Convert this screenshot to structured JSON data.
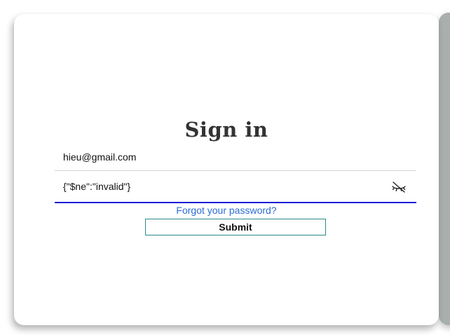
{
  "form": {
    "title": "Sign in",
    "email_value": "hieu@gmail.com",
    "password_value": "{\"$ne\":\"invalid\"}",
    "password_visibility_icon": "eye-off-icon",
    "forgot_label": "Forgot your password?",
    "submit_label": "Submit"
  },
  "colors": {
    "accent_underline": "#1a1ad6",
    "link": "#2a6bd6",
    "submit_border": "#2b8a86",
    "side_panel": "#a9afad"
  }
}
